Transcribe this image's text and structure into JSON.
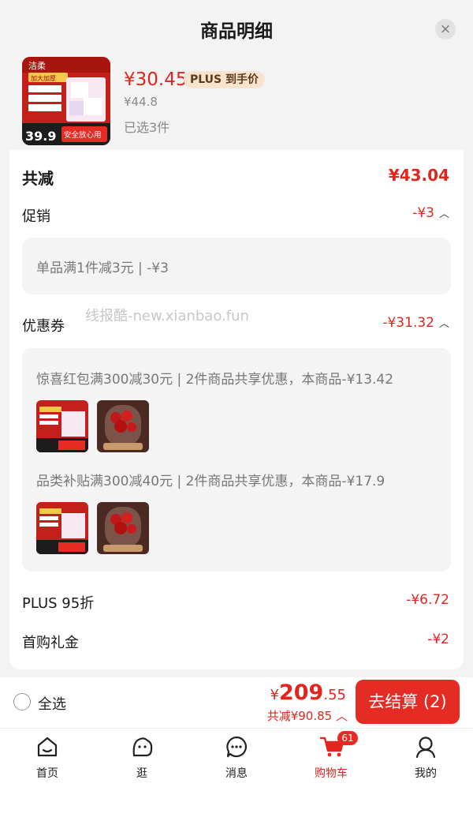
{
  "header": {
    "title": "商品明细",
    "close_label": "×"
  },
  "product": {
    "thumb_text_brand": "洁柔",
    "thumb_text_thicker": "加大加厚",
    "thumb_text_price": "39.9",
    "thumb_text_safe": "安全放心用",
    "price": "¥30.45",
    "plus_badge": "PLUS 到手价",
    "original_price": "¥44.8",
    "selected_count": "已选3件"
  },
  "summary": {
    "total_label": "共减",
    "total_value": "¥43.04",
    "promo_label": "促销",
    "promo_value": "-¥3",
    "promo_detail": "单品满1件减3元 | -¥3",
    "coupon_label": "优惠券",
    "coupon_value": "-¥31.32",
    "coupon_detail_1": "惊喜红包满300减30元 | 2件商品共享优惠，本商品-¥13.42",
    "coupon_detail_2": "品类补贴满300减40元 | 2件商品共享优惠，本商品-¥17.9",
    "plus_label": "PLUS 95折",
    "plus_value": "-¥6.72",
    "first_gift_label": "首购礼金",
    "first_gift_value": "-¥2"
  },
  "watermark": "线报酷-new.xianbao.fun",
  "checkout": {
    "select_all": "全选",
    "price_symbol": "¥",
    "price_int": "209",
    "price_dec": ".55",
    "saved": "共减¥90.85",
    "button": "去结算 (2)"
  },
  "tabs": [
    {
      "label": "首页",
      "icon": "home-icon"
    },
    {
      "label": "逛",
      "icon": "browse-face-icon"
    },
    {
      "label": "消息",
      "icon": "message-icon"
    },
    {
      "label": "购物车",
      "icon": "cart-icon",
      "badge": "61",
      "active": true
    },
    {
      "label": "我的",
      "icon": "profile-icon"
    }
  ],
  "colors": {
    "accent": "#e2261e",
    "button": "#e42b24",
    "plus_badge_bg": "#f8e3cf"
  }
}
